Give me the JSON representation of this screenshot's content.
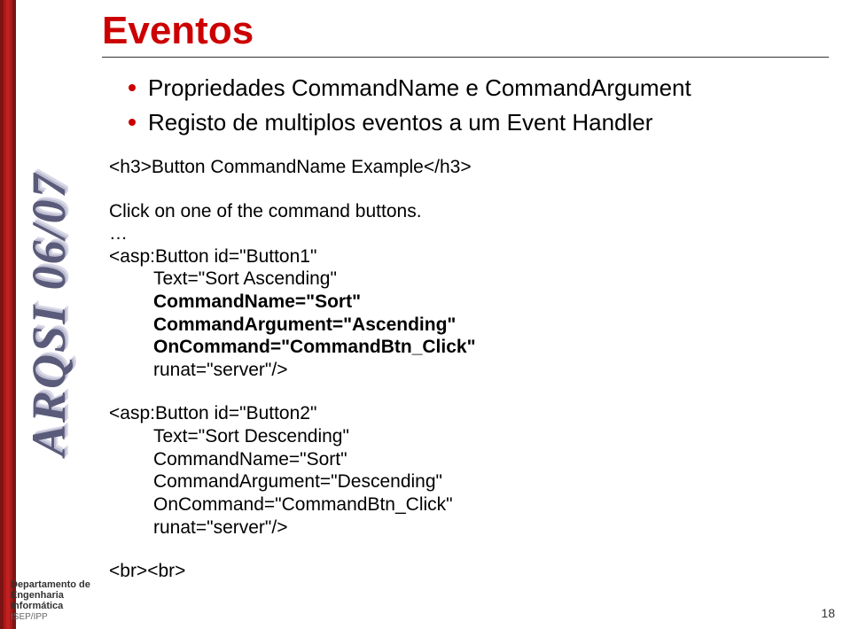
{
  "sidebar": {
    "vertical_title": "ARQSI 06/07",
    "footer": {
      "line1": "Departamento de",
      "line2": "Engenharia Informática",
      "line3": "ISEP/IPP"
    }
  },
  "title": "Eventos",
  "bullets": [
    "Propriedades CommandName e CommandArgument",
    "Registo de multiplos eventos a um Event Handler"
  ],
  "code": {
    "h3_line": "<h3>Button CommandName Example</h3>",
    "click_line": "Click on one of the command buttons.",
    "ellipsis": "…",
    "btn1": {
      "open": "<asp:Button id=\"Button1\"",
      "text": "Text=\"Sort Ascending\"",
      "cmdname": "CommandName=\"Sort\"",
      "cmdarg": "CommandArgument=\"Ascending\"",
      "oncmd": "OnCommand=\"CommandBtn_Click\"",
      "runat": "runat=\"server\"/>"
    },
    "btn2": {
      "open": "<asp:Button id=\"Button2\"",
      "text": "Text=\"Sort Descending\"",
      "cmdname": "CommandName=\"Sort\"",
      "cmdarg": "CommandArgument=\"Descending\"",
      "oncmd": "OnCommand=\"CommandBtn_Click\"",
      "runat": "runat=\"server\"/>"
    },
    "brbr": "<br><br>"
  },
  "page_number": "18"
}
